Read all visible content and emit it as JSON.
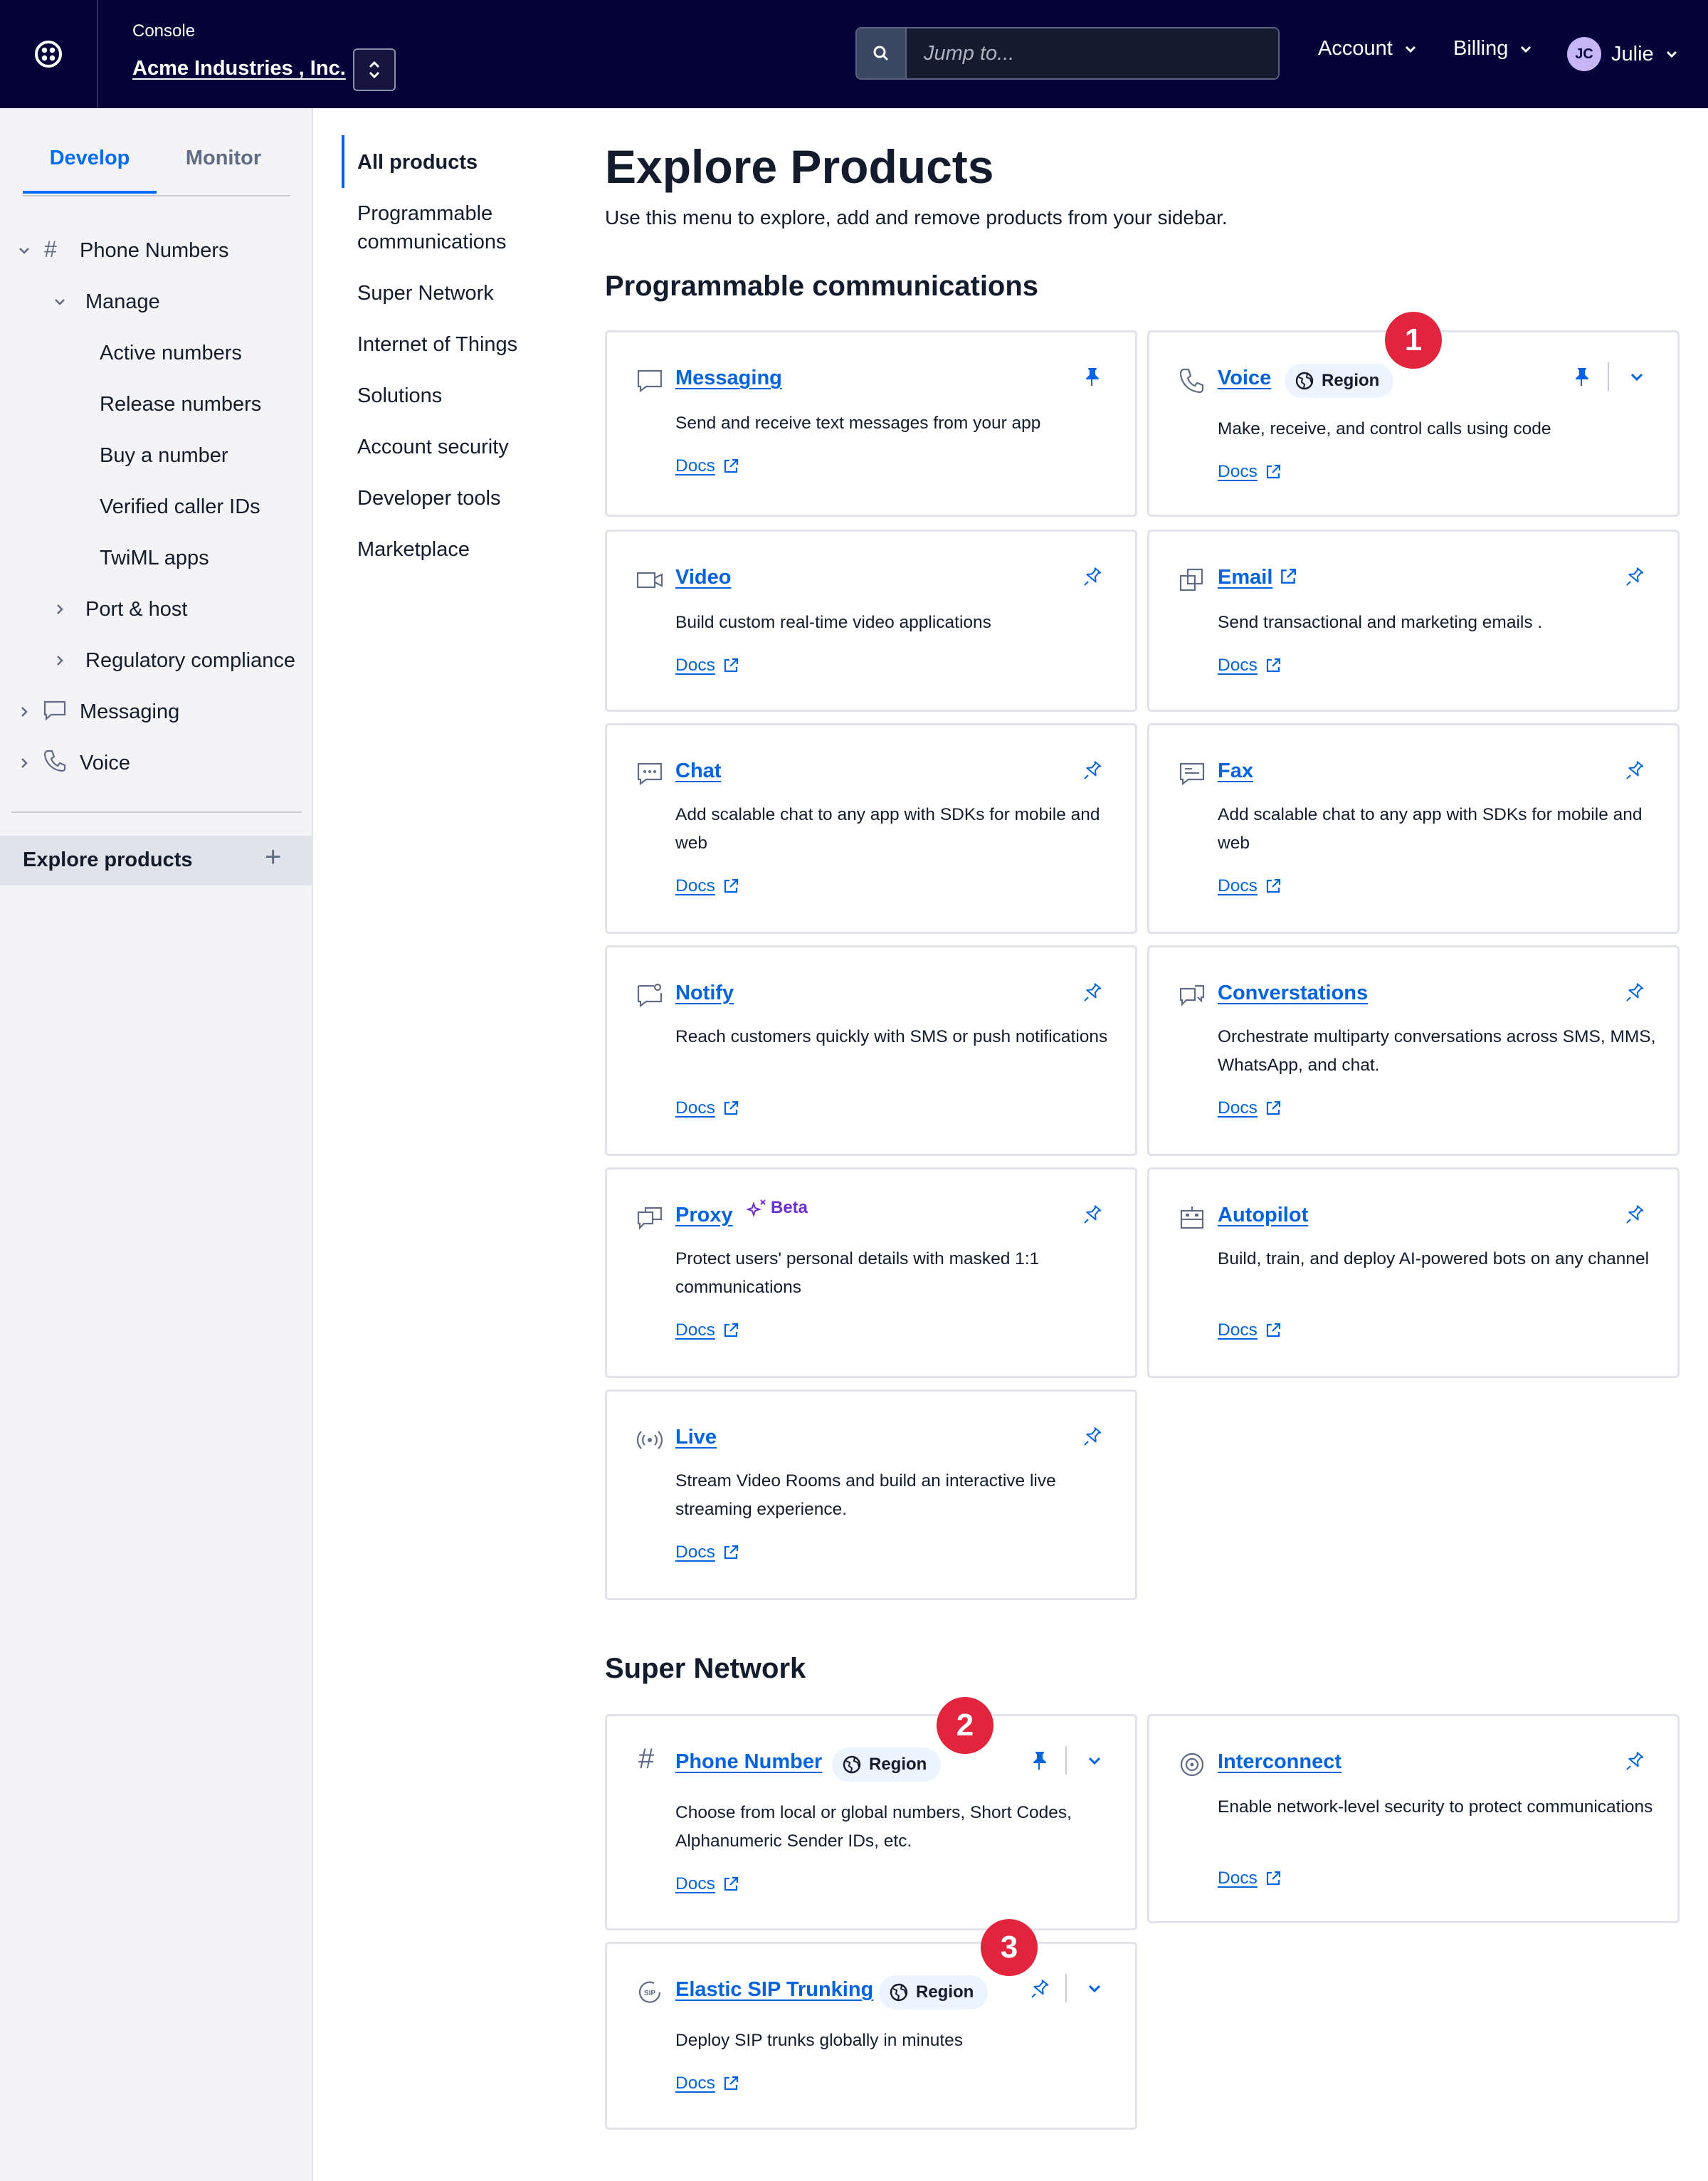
{
  "topbar": {
    "console_label": "Console",
    "account_name": "Acme Industries , Inc.",
    "search_placeholder": "Jump to...",
    "menu_account": "Account",
    "menu_billing": "Billing",
    "user_initials": "JC",
    "user_name": "Julie"
  },
  "sidebar": {
    "tab_develop": "Develop",
    "tab_monitor": "Monitor",
    "phone_numbers": "Phone Numbers",
    "manage": "Manage",
    "manage_items": [
      "Active numbers",
      "Release numbers",
      "Buy a number",
      "Verified caller IDs",
      "TwiML apps"
    ],
    "port_host": "Port & host",
    "regulatory": "Regulatory compliance",
    "messaging": "Messaging",
    "voice": "Voice",
    "explore": "Explore products"
  },
  "catnav": {
    "items": [
      "All products",
      "Programmable communications",
      "Super Network",
      "Internet of Things",
      "Solutions",
      "Account security",
      "Developer tools",
      "Marketplace"
    ]
  },
  "main": {
    "title": "Explore Products",
    "subtitle": "Use this menu to explore, add and remove products from your sidebar.",
    "section1": "Programmable communications",
    "section2": "Super Network",
    "docs_label": "Docs",
    "region_label": "Region",
    "beta_label": "Beta",
    "markers": [
      "1",
      "2",
      "3"
    ]
  },
  "products": {
    "messaging": {
      "title": "Messaging",
      "desc": "Send and receive text messages from your app",
      "icon": "message-icon"
    },
    "voice": {
      "title": "Voice",
      "desc": "Make, receive, and control calls using code",
      "icon": "phone-icon"
    },
    "video": {
      "title": "Video",
      "desc": "Build custom real-time video applications",
      "icon": "video-icon"
    },
    "email": {
      "title": "Email",
      "desc": "Send transactional and marketing emails .",
      "icon": "email-icon"
    },
    "chat": {
      "title": "Chat",
      "desc": "Add scalable chat to any app with SDKs for mobile and web",
      "icon": "chat-icon"
    },
    "fax": {
      "title": "Fax",
      "desc": "Add scalable chat to any app with SDKs for mobile and web",
      "icon": "fax-icon"
    },
    "notify": {
      "title": "Notify",
      "desc": "Reach customers quickly with SMS or push notifications",
      "icon": "notify-icon"
    },
    "conversations": {
      "title": "Converstations",
      "desc": "Orchestrate multiparty conversations across SMS, MMS, WhatsApp, and chat.",
      "icon": "conversations-icon"
    },
    "proxy": {
      "title": "Proxy",
      "desc": "Protect users' personal details with masked 1:1 communications",
      "icon": "proxy-icon"
    },
    "autopilot": {
      "title": "Autopilot",
      "desc": "Build, train, and deploy AI-powered bots on any channel",
      "icon": "robot-icon"
    },
    "live": {
      "title": "Live",
      "desc": "Stream Video Rooms and build an interactive live streaming experience.",
      "icon": "broadcast-icon"
    },
    "phone_number": {
      "title": "Phone Number",
      "desc": "Choose from local or global numbers, Short Codes, Alphanumeric Sender IDs, etc.",
      "icon": "hash-icon"
    },
    "interconnect": {
      "title": "Interconnect",
      "desc": "Enable network-level security to protect communications",
      "icon": "interconnect-icon"
    },
    "sip": {
      "title": "Elastic SIP Trunking",
      "desc": "Deploy SIP trunks globally in minutes",
      "icon": "sip-icon"
    }
  },
  "colors": {
    "topbar": "#06033a",
    "link": "#0263e0",
    "marker": "#e2253c",
    "beta": "#6d2ed1"
  }
}
